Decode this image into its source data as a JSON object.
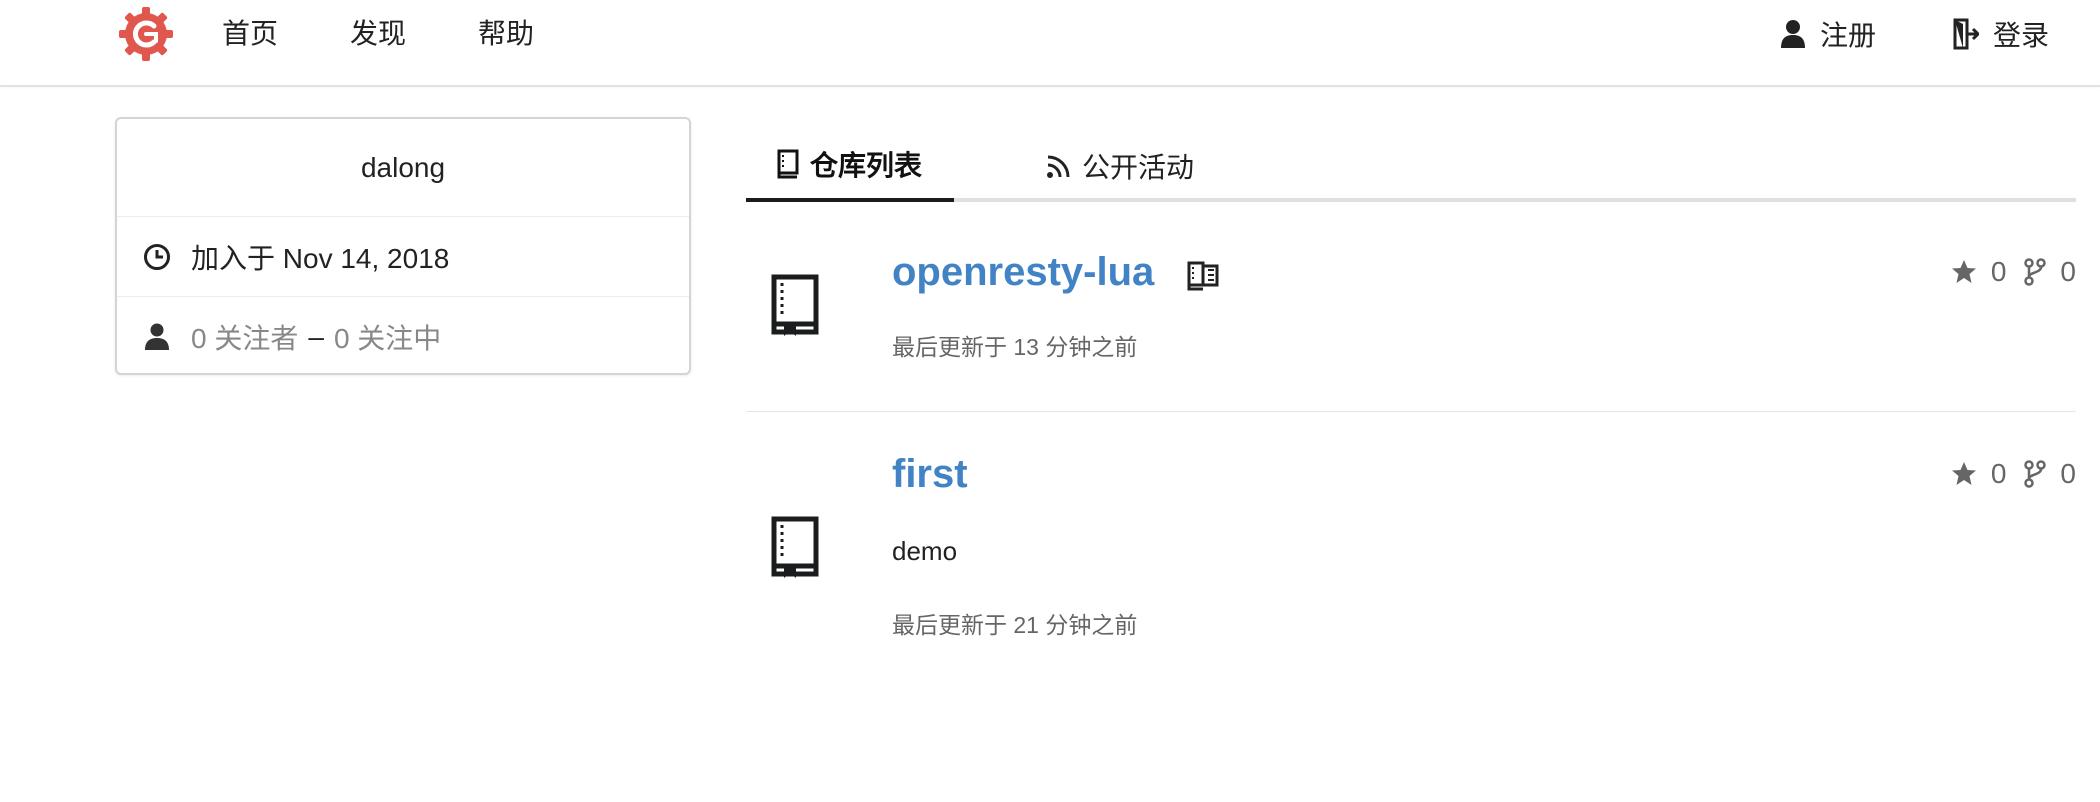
{
  "nav": {
    "home": "首页",
    "explore": "发现",
    "help": "帮助",
    "register": "注册",
    "login": "登录"
  },
  "profile": {
    "username": "dalong",
    "joined": "加入于 Nov 14, 2018",
    "followers": "0 关注者",
    "separator": "–",
    "following": "0 关注中"
  },
  "tabs": {
    "repos": "仓库列表",
    "activity": "公开活动"
  },
  "repos": [
    {
      "name": "openresty-lua",
      "mirror": true,
      "description": "",
      "updated": "最后更新于 13 分钟之前",
      "stars": "0",
      "forks": "0"
    },
    {
      "name": "first",
      "mirror": false,
      "description": "demo",
      "updated": "最后更新于 21 分钟之前",
      "stars": "0",
      "forks": "0"
    }
  ],
  "colors": {
    "link": "#4183c4",
    "logo": "#e0574d"
  },
  "icons": {
    "logo": "gogs-logo",
    "register": "user-icon",
    "login": "sign-in-icon",
    "joined": "clock-icon",
    "followers": "person-icon",
    "repos_tab": "book-icon",
    "activity_tab": "rss-icon",
    "repo": "repo-icon",
    "mirror": "mirror-icon",
    "stars": "star-icon",
    "forks": "fork-icon"
  }
}
